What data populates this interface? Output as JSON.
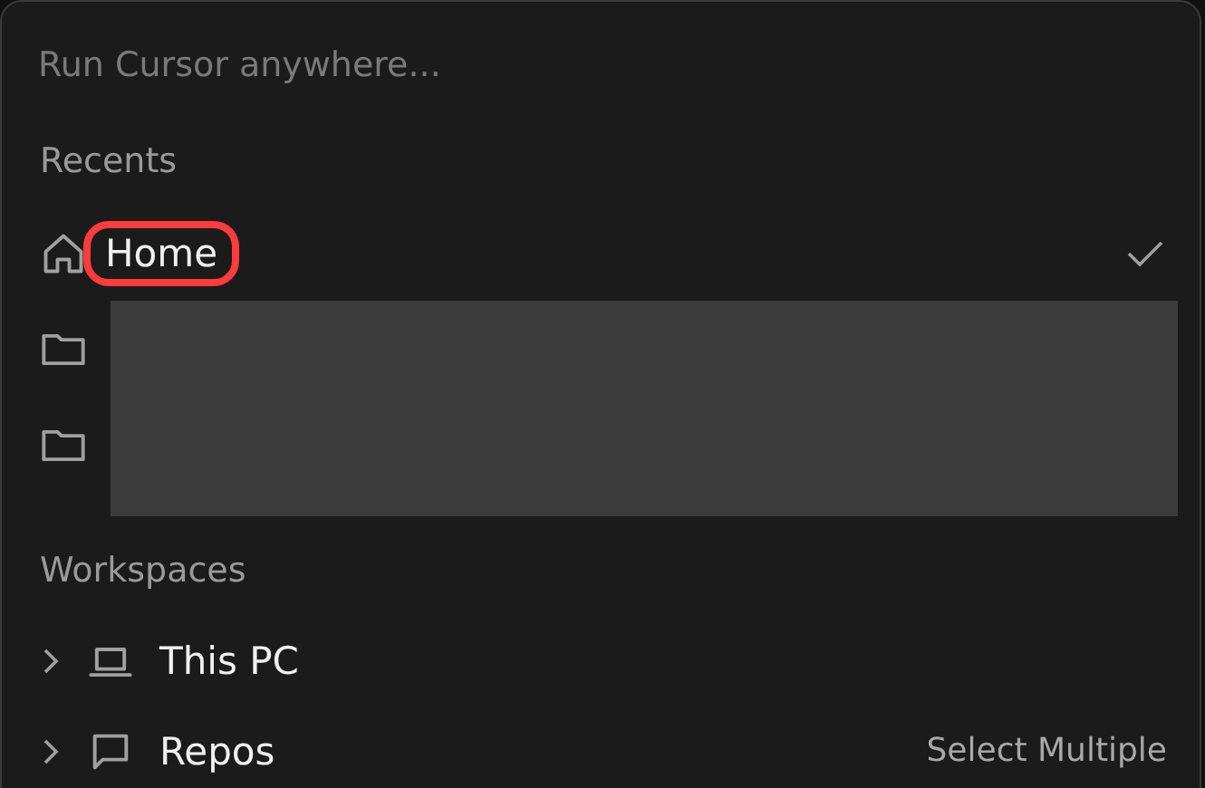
{
  "search": {
    "placeholder": "Run Cursor anywhere..."
  },
  "recents": {
    "title": "Recents",
    "items": [
      {
        "kind": "home",
        "label": "Home",
        "selected": true,
        "highlighted": true
      },
      {
        "kind": "folder",
        "selected": false,
        "highlighted": false
      },
      {
        "kind": "folder",
        "selected": false,
        "highlighted": false
      }
    ],
    "redacted": true
  },
  "workspaces": {
    "title": "Workspaces",
    "items": [
      {
        "kind": "computer",
        "label": "This PC",
        "expanded": false
      },
      {
        "kind": "repo",
        "label": "Repos",
        "expanded": false,
        "action": "Select Multiple"
      }
    ]
  }
}
